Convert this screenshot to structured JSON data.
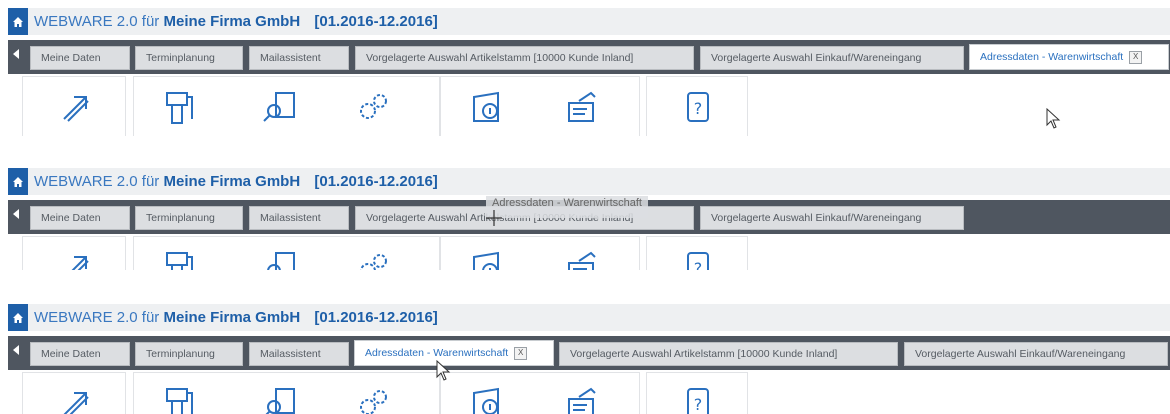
{
  "app": {
    "title_app": "WEBWARE 2.0 für",
    "title_company": "Meine Firma GmbH",
    "title_period": "[01.2016-12.2016]"
  },
  "colors": {
    "brand": "#1e5fa8",
    "tabbar": "#4f5660",
    "active_tab_text": "#2a70bf"
  },
  "frames": [
    {
      "tabs": [
        {
          "label": "Meine Daten"
        },
        {
          "label": "Terminplanung"
        },
        {
          "label": "Mailassistent"
        },
        {
          "label": "Vorgelagerte Auswahl Artikelstamm [10000 Kunde Inland]"
        },
        {
          "label": "Vorgelagerte Auswahl Einkauf/Wareneingang"
        },
        {
          "label": "Adressdaten - Warenwirtschaft",
          "active": true,
          "close": "X"
        }
      ]
    },
    {
      "tabs": [
        {
          "label": "Meine Daten"
        },
        {
          "label": "Terminplanung"
        },
        {
          "label": "Mailassistent"
        },
        {
          "label": "Vorgelagerte Auswahl Artikelstamm [10000 Kunde Inland]"
        },
        {
          "label": "Vorgelagerte Auswahl Einkauf/Wareneingang"
        }
      ],
      "drag_ghost": "Adressdaten - Warenwirtschaft"
    },
    {
      "tabs": [
        {
          "label": "Meine Daten"
        },
        {
          "label": "Terminplanung"
        },
        {
          "label": "Mailassistent"
        },
        {
          "label": "Adressdaten - Warenwirtschaft",
          "active": true,
          "close": "X"
        },
        {
          "label": "Vorgelagerte Auswahl Artikelstamm [10000 Kunde Inland]"
        },
        {
          "label": "Vorgelagerte Auswahl Einkauf/Wareneingang"
        }
      ]
    }
  ],
  "toolbar_icons": [
    "arrow-jump-icon",
    "document-stack-icon",
    "document-search-icon",
    "gears-icon",
    "folder-info-icon",
    "document-edit-icon",
    "help-icon"
  ]
}
